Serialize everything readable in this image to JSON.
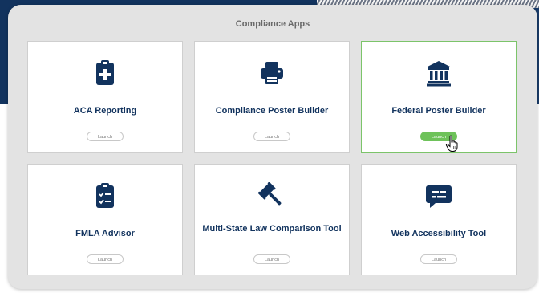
{
  "panel": {
    "title": "Compliance Apps"
  },
  "apps": [
    {
      "name": "ACA Reporting",
      "launch_label": "Launch",
      "icon": "clipboard-plus-icon"
    },
    {
      "name": "Compliance Poster Builder",
      "launch_label": "Launch",
      "icon": "printer-icon"
    },
    {
      "name": "Federal Poster Builder",
      "launch_label": "Launch",
      "icon": "government-building-icon",
      "active": true
    },
    {
      "name": "FMLA Advisor",
      "launch_label": "Launch",
      "icon": "clipboard-checklist-icon"
    },
    {
      "name": "Multi-State Law Comparison Tool",
      "launch_label": "Launch",
      "icon": "gavel-icon"
    },
    {
      "name": "Web Accessibility Tool",
      "launch_label": "Launch",
      "icon": "chat-bubble-icon"
    }
  ],
  "colors": {
    "navy": "#12335e",
    "accent_green": "#6ec25a",
    "panel_bg": "#e3e3e3"
  }
}
